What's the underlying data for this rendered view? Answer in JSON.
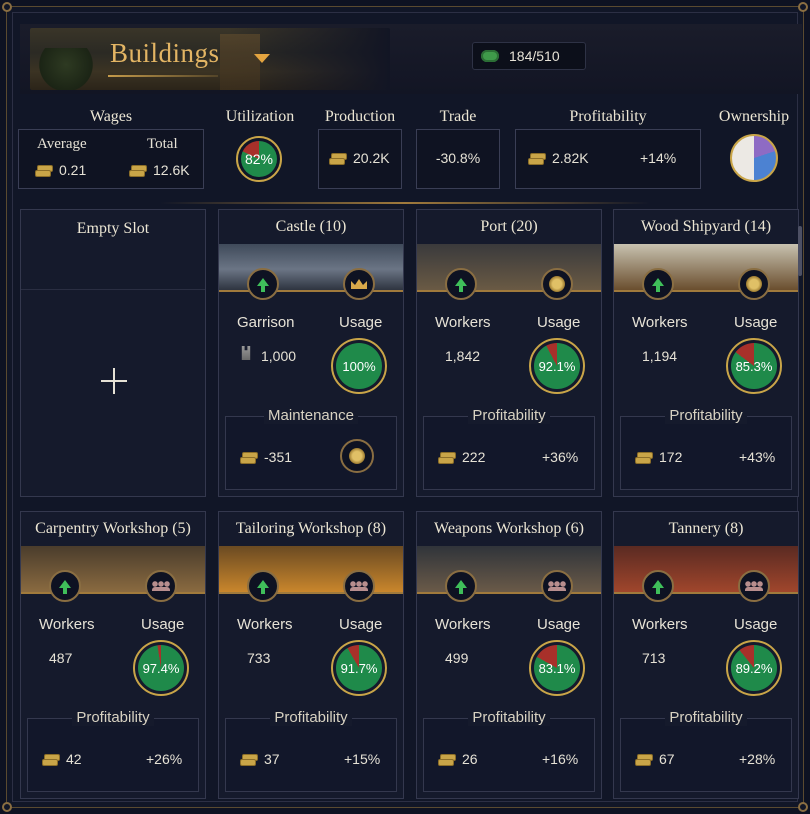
{
  "header": {
    "title": "Buildings",
    "capacity": "184/510"
  },
  "stats": {
    "wages": {
      "label": "Wages",
      "average_label": "Average",
      "average": "0.21",
      "total_label": "Total",
      "total": "12.6K"
    },
    "utilization": {
      "label": "Utilization",
      "value": "82%",
      "fraction": 0.82
    },
    "production": {
      "label": "Production",
      "value": "20.2K"
    },
    "trade": {
      "label": "Trade",
      "value": "-30.8%"
    },
    "profitability": {
      "label": "Profitability",
      "value": "2.82K",
      "change": "+14%"
    },
    "ownership": {
      "label": "Ownership",
      "slices": [
        {
          "color": "#8e6bc4",
          "share": 0.2
        },
        {
          "color": "#4c82d2",
          "share": 0.3
        },
        {
          "color": "#ece9e4",
          "share": 0.5
        }
      ]
    }
  },
  "empty_slot": {
    "label": "Empty Slot"
  },
  "castle": {
    "title": "Castle (10)",
    "garrison_label": "Garrison",
    "garrison": "1,000",
    "usage_label": "Usage",
    "usage": "100%",
    "usage_fraction": 1.0,
    "maintenance_label": "Maintenance",
    "maintenance": "-351"
  },
  "cards": [
    {
      "title": "Port (20)",
      "workers_label": "Workers",
      "workers": "1,842",
      "usage_label": "Usage",
      "usage": "92.1%",
      "usage_fraction": 0.921,
      "profit_label": "Profitability",
      "profit": "222",
      "change": "+36%",
      "colors": [
        "#3a3a3c",
        "#6a5a44"
      ]
    },
    {
      "title": "Wood Shipyard (14)",
      "workers_label": "Workers",
      "workers": "1,194",
      "usage_label": "Usage",
      "usage": "85.3%",
      "usage_fraction": 0.853,
      "profit_label": "Profitability",
      "profit": "172",
      "change": "+43%",
      "colors": [
        "#c8c2b0",
        "#6a4e2e"
      ]
    },
    {
      "title": "Carpentry Workshop  (5)",
      "workers_label": "Workers",
      "workers": "487",
      "usage_label": "Usage",
      "usage": "97.4%",
      "usage_fraction": 0.974,
      "profit_label": "Profitability",
      "profit": "42",
      "change": "+26%",
      "colors": [
        "#4a3c2c",
        "#8a6a40"
      ]
    },
    {
      "title": "Tailoring Workshop (8)",
      "workers_label": "Workers",
      "workers": "733",
      "usage_label": "Usage",
      "usage": "91.7%",
      "usage_fraction": 0.917,
      "profit_label": "Profitability",
      "profit": "37",
      "change": "+15%",
      "colors": [
        "#6a4a22",
        "#c9862c"
      ]
    },
    {
      "title": "Weapons Workshop (6)",
      "workers_label": "Workers",
      "workers": "499",
      "usage_label": "Usage",
      "usage": "83.1%",
      "usage_fraction": 0.831,
      "profit_label": "Profitability",
      "profit": "26",
      "change": "+16%",
      "colors": [
        "#30343a",
        "#6a5a48"
      ]
    },
    {
      "title": "Tannery  (8)",
      "workers_label": "Workers",
      "workers": "713",
      "usage_label": "Usage",
      "usage": "89.2%",
      "usage_fraction": 0.892,
      "profit_label": "Profitability",
      "profit": "67",
      "change": "+28%",
      "colors": [
        "#5a2a22",
        "#a0462c"
      ]
    }
  ],
  "icons": {
    "upgrade": "arrow-up-icon",
    "castle_badge": "crown-icon",
    "trade_badge": "coins-icon",
    "workshop_badge": "people-icon",
    "currency": "gold-coins-icon",
    "capacity": "building-slot-icon"
  },
  "colors": {
    "gauge_fill": "#1f8a4a",
    "gauge_rest": "#a8302a",
    "accent": "#e3b564",
    "positive": "#5ec45a",
    "negative": "#e0453e"
  }
}
